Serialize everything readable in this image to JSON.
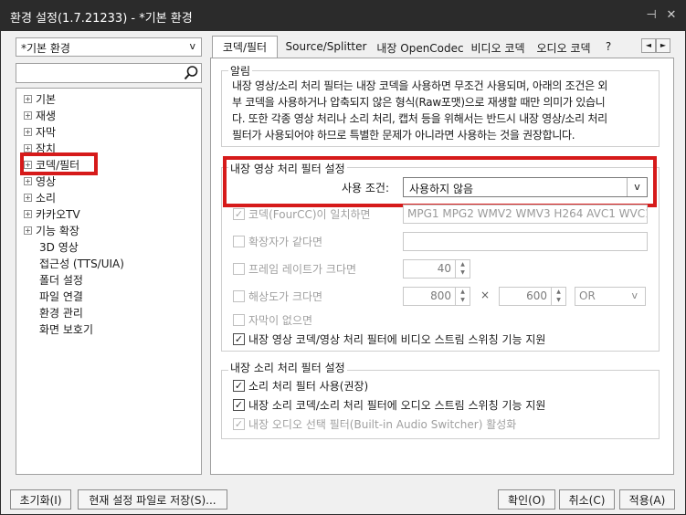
{
  "window": {
    "title": "환경 설정(1.7.21233) - *기본 환경",
    "pin_glyph": "⊣",
    "close_glyph": "✕"
  },
  "sidebar": {
    "preset": {
      "value": "*기본 환경",
      "arrow": "v"
    },
    "search": {
      "value": "",
      "placeholder": ""
    },
    "tree": [
      {
        "label": "기본",
        "expandable": true
      },
      {
        "label": "재생",
        "expandable": true
      },
      {
        "label": "자막",
        "expandable": true
      },
      {
        "label": "장치",
        "expandable": true
      },
      {
        "label": "코덱/필터",
        "expandable": true,
        "selected": true
      },
      {
        "label": "영상",
        "expandable": true
      },
      {
        "label": "소리",
        "expandable": true
      },
      {
        "label": "카카오TV",
        "expandable": true
      },
      {
        "label": "기능 확장",
        "expandable": true
      },
      {
        "label": "3D 영상",
        "expandable": false
      },
      {
        "label": "접근성 (TTS/UIA)",
        "expandable": false
      },
      {
        "label": "폴더 설정",
        "expandable": false
      },
      {
        "label": "파일 연결",
        "expandable": false
      },
      {
        "label": "환경 관리",
        "expandable": false
      },
      {
        "label": "화면 보호기",
        "expandable": false
      }
    ],
    "expand_glyph": "+"
  },
  "tabs": {
    "items": [
      {
        "label": "코덱/필터",
        "active": true
      },
      {
        "label": "Source/Splitter"
      },
      {
        "label": "내장 OpenCodec"
      },
      {
        "label": "비디오 코덱"
      },
      {
        "label": "오디오 코덱"
      },
      {
        "label": "?"
      }
    ],
    "prev_glyph": "◄",
    "next_glyph": "►"
  },
  "notice": {
    "title": "알림",
    "lines": [
      "내장 영상/소리 처리 필터는 내장 코덱을 사용하면 무조건 사용되며, 아래의 조건은 외",
      "부 코덱을 사용하거나 압축되지 않은 형식(Raw포맷)으로 재생할 때만 의미가 있습니",
      "다. 또한 각종 영상 처리나 소리 처리, 캡처 등을 위해서는 반드시 내장 영상/소리 처리",
      "필터가 사용되어야 하므로 특별한 문제가 아니라면 사용하는 것을 권장합니다."
    ]
  },
  "video_filter": {
    "title": "내장 영상 처리 필터 설정",
    "condition_label": "사용 조건:",
    "condition_value": "사용하지 않음",
    "condition_arrow": "v",
    "codec_match": {
      "label": "코덱(FourCC)이 일치하면",
      "checked": true,
      "enabled": false,
      "value": "MPG1 MPG2 WMV2 WMV3 H264 AVC1 WVC1"
    },
    "ext_match": {
      "label": "확장자가 같다면",
      "checked": false,
      "enabled": false,
      "value": ""
    },
    "framerate": {
      "label": "프레임 레이트가 크다면",
      "checked": false,
      "enabled": false,
      "value": "40"
    },
    "resolution": {
      "label": "해상도가 크다면",
      "checked": false,
      "enabled": false,
      "width": "800",
      "times": "×",
      "height": "600",
      "op": "OR",
      "op_arrow": "v"
    },
    "no_subtitle": {
      "label": "자막이 없으면",
      "checked": false,
      "enabled": false
    },
    "stream_switch": {
      "label": "내장 영상 코덱/영상 처리 필터에  비디오 스트림 스위칭 기능 지원",
      "checked": true,
      "enabled": true
    },
    "spin_glyph": "▲\n▼"
  },
  "audio_filter": {
    "title": "내장 소리 처리 필터 설정",
    "use_filter": {
      "label": "소리 처리 필터 사용(권장)",
      "checked": true,
      "enabled": true
    },
    "stream_switch": {
      "label": "내장 소리 코덱/소리 처리 필터에  오디오 스트림 스위칭 기능 지원",
      "checked": true,
      "enabled": true
    },
    "audio_switcher": {
      "label": "내장 오디오 선택 필터(Built-in Audio Switcher) 활성화",
      "checked": true,
      "enabled": false
    }
  },
  "footer": {
    "reset_label": "초기화(I)",
    "save_label": "현재 설정 파일로 저장(S)...",
    "ok_label": "확인(O)",
    "cancel_label": "취소(C)",
    "apply_label": "적용(A)"
  },
  "colors": {
    "titlebar_bg": "#2b2b2b",
    "highlight_border": "#d61a1a",
    "panel_bg": "#ffffff",
    "window_bg": "#f0f0f0"
  },
  "check_glyph": "✓"
}
